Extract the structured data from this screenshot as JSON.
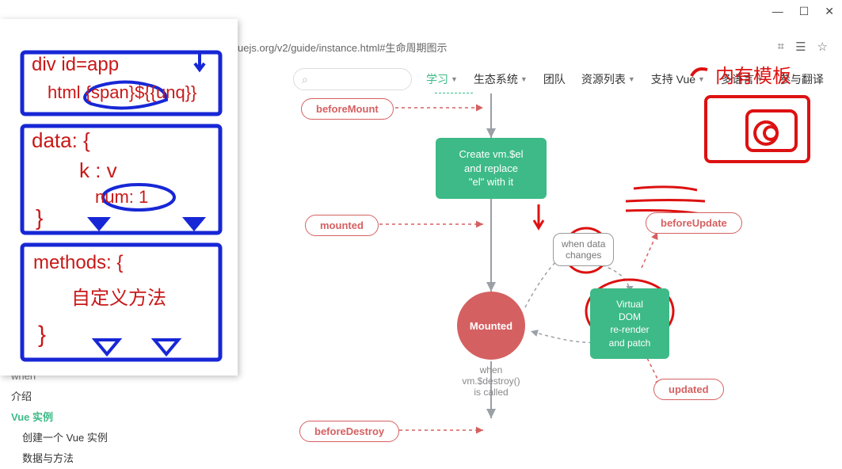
{
  "window": {
    "min": "—",
    "max": "☐",
    "close": "✕"
  },
  "addr": {
    "url": "uejs.org/v2/guide/instance.html#生命周期图示",
    "icon_qr": "⌗",
    "icon_reader": "☰",
    "icon_star": "☆"
  },
  "topnav": {
    "items": [
      "列表",
      "支持 Vue",
      "多语言",
      "参与翻译"
    ]
  },
  "pagehdr": {
    "search_glyph": "⌕",
    "nav": [
      "学习",
      "生态系统",
      "团队",
      "资源列表",
      "支持 Vue",
      "多语言",
      "参与翻译"
    ],
    "dropdown_flags": [
      true,
      true,
      false,
      true,
      true,
      true,
      false
    ],
    "active_index": 0
  },
  "sidebar": {
    "when": "when",
    "items": [
      "介绍",
      "Vue 实例",
      "创建一个 Vue 实例",
      "数据与方法"
    ]
  },
  "diagram": {
    "hooks": {
      "beforeMount": "beforeMount",
      "mounted": "mounted",
      "beforeUpdate": "beforeUpdate",
      "updated": "updated",
      "beforeDestroy": "beforeDestroy"
    },
    "green_replace": "Create vm.$el\nand replace\n\"el\" with it",
    "green_rerender": "Virtual DOM\nre-render\nand patch",
    "mounted_circle": "Mounted",
    "cond_when_data": "when data\nchanges",
    "lbl_when_destroy": "when\nvm.$destroy()\nis called"
  },
  "handwriting": {
    "l1": "div id=app",
    "l2": "html {span}${{unq}}",
    "l3": "data: {",
    "l4": "k : v",
    "l5": "num: 1",
    "l6": "}",
    "l7": "methods: {",
    "l8": "自定义方法",
    "l9": "}"
  },
  "scribble_tr_text": "内有模板"
}
